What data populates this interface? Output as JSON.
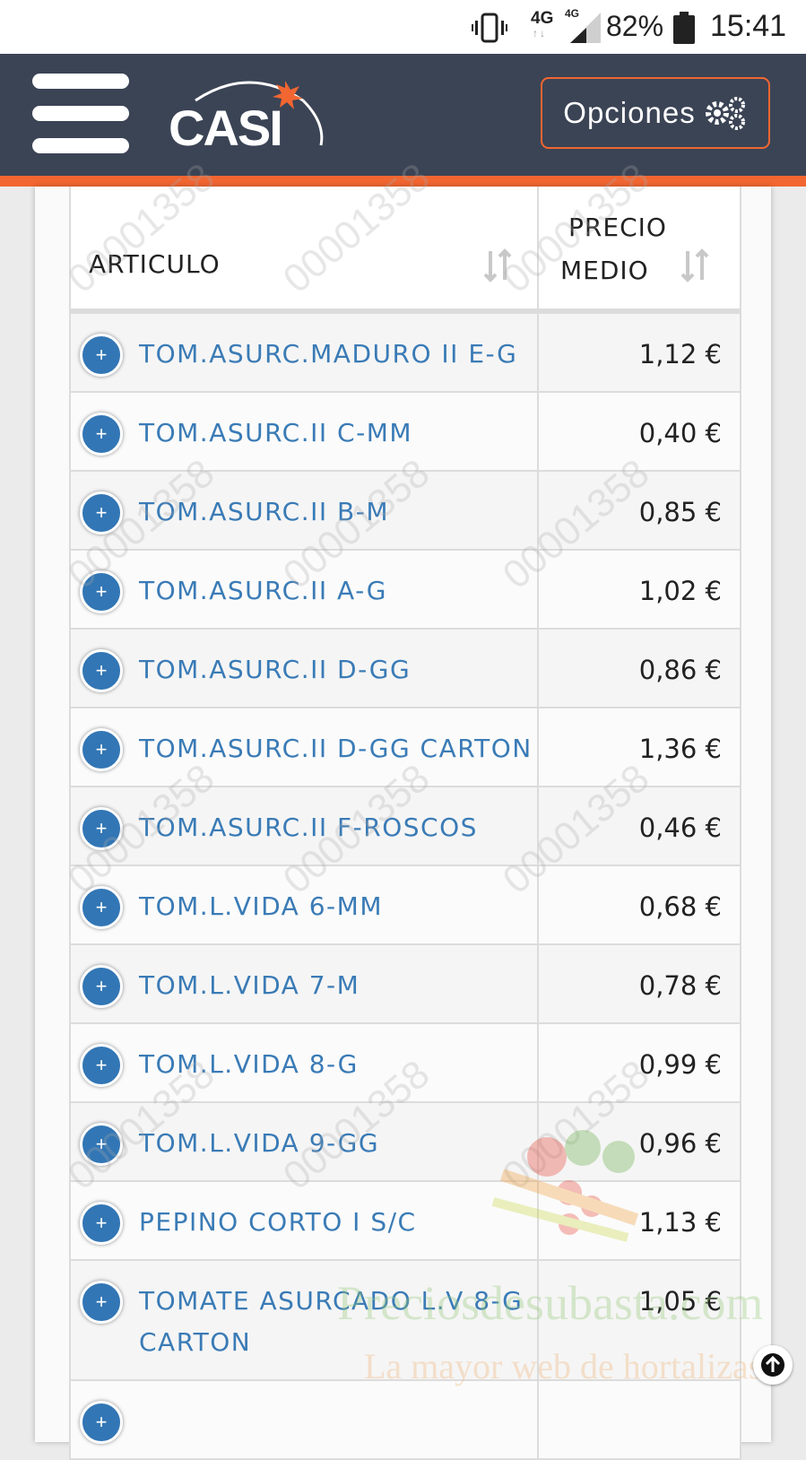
{
  "status_bar": {
    "network1": "4G",
    "network2": "4G",
    "battery": "82%",
    "time": "15:41"
  },
  "header": {
    "logo_text": "CASI",
    "options_label": "Opciones"
  },
  "table": {
    "columns": [
      "ARTICULO",
      "PRECIO MEDIO"
    ],
    "price_header_line1": "PRECIO",
    "price_header_line2": "MEDIO",
    "rows": [
      {
        "name": "TOM.ASURC.MADURO II E-G",
        "price": "1,12 €"
      },
      {
        "name": "TOM.ASURC.II C-MM",
        "price": "0,40 €"
      },
      {
        "name": "TOM.ASURC.II B-M",
        "price": "0,85 €"
      },
      {
        "name": "TOM.ASURC.II A-G",
        "price": "1,02 €"
      },
      {
        "name": "TOM.ASURC.II D-GG",
        "price": "0,86 €"
      },
      {
        "name": "TOM.ASURC.II D-GG CARTON",
        "price": "1,36 €"
      },
      {
        "name": "TOM.ASURC.II F-ROSCOS",
        "price": "0,46 €"
      },
      {
        "name": "TOM.L.VIDA 6-MM",
        "price": "0,68 €"
      },
      {
        "name": "TOM.L.VIDA 7-M",
        "price": "0,78 €"
      },
      {
        "name": "TOM.L.VIDA 8-G",
        "price": "0,99 €"
      },
      {
        "name": "TOM.L.VIDA 9-GG",
        "price": "0,96 €"
      },
      {
        "name": "PEPINO CORTO I S/C",
        "price": "1,13 €"
      },
      {
        "name": "TOMATE ASURCADO L.V 8-G CARTON",
        "price": "1,05 €"
      }
    ]
  },
  "watermark": {
    "site": "Preciosdesubasta.com",
    "tagline": "La mayor web de hortalizas",
    "code": "00001358"
  },
  "icons": {
    "expand": "+"
  }
}
